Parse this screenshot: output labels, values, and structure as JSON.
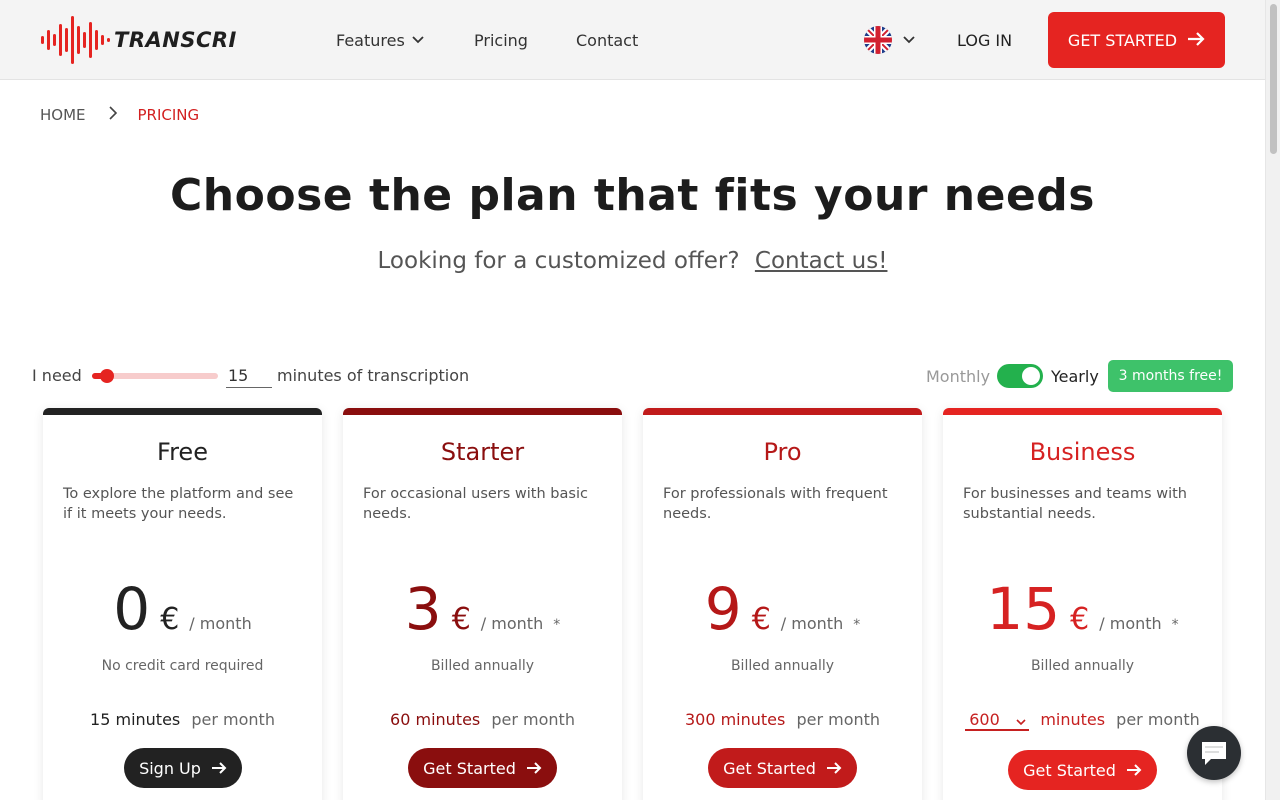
{
  "header": {
    "logo_text": "TRANSCRI",
    "nav": {
      "features": "Features",
      "pricing": "Pricing",
      "contact": "Contact"
    },
    "language_icon": "uk-flag-icon",
    "login": "LOG IN",
    "get_started": "GET STARTED"
  },
  "breadcrumb": {
    "home": "HOME",
    "current": "PRICING"
  },
  "hero": {
    "title": "Choose the plan that fits your needs",
    "subtitle": "Looking for a customized offer?",
    "contact_link": "Contact us!"
  },
  "controls": {
    "need_label": "I need",
    "minutes_value": "15",
    "minutes_label": "minutes of transcription",
    "slider_fraction": 0.06,
    "billing_monthly": "Monthly",
    "billing_yearly": "Yearly",
    "yearly_selected": true,
    "free_badge": "3 months free!"
  },
  "plans": [
    {
      "name": "Free",
      "description": "To explore the platform and see if it meets your needs.",
      "price": "0",
      "currency": "€",
      "period": "/ month",
      "footnote_mark": "",
      "billing_note": "No credit card required",
      "minutes": "15 minutes",
      "per": "per month",
      "button": "Sign Up",
      "color": "#222222"
    },
    {
      "name": "Starter",
      "description": "For occasional users with basic needs.",
      "price": "3",
      "currency": "€",
      "period": "/ month",
      "footnote_mark": "*",
      "billing_note": "Billed annually",
      "minutes": "60 minutes",
      "per": "per month",
      "button": "Get Started",
      "color": "#8a0e0e"
    },
    {
      "name": "Pro",
      "description": "For professionals with frequent needs.",
      "price": "9",
      "currency": "€",
      "period": "/ month",
      "footnote_mark": "*",
      "billing_note": "Billed annually",
      "minutes": "300 minutes",
      "per": "per month",
      "button": "Get Started",
      "color": "#c11b1b"
    },
    {
      "name": "Business",
      "description": "For businesses and teams with substantial needs.",
      "price": "15",
      "currency": "€",
      "period": "/ month",
      "footnote_mark": "*",
      "billing_note": "Billed annually",
      "minutes_select": "600",
      "minutes_unit": "minutes",
      "per": "per month",
      "button": "Get Started",
      "color": "#e52421"
    }
  ],
  "chat_icon": "chat-bubble-icon",
  "colors": {
    "brand_red": "#e52421",
    "toggle_green": "#23b14d",
    "badge_green": "#3ec26a"
  }
}
